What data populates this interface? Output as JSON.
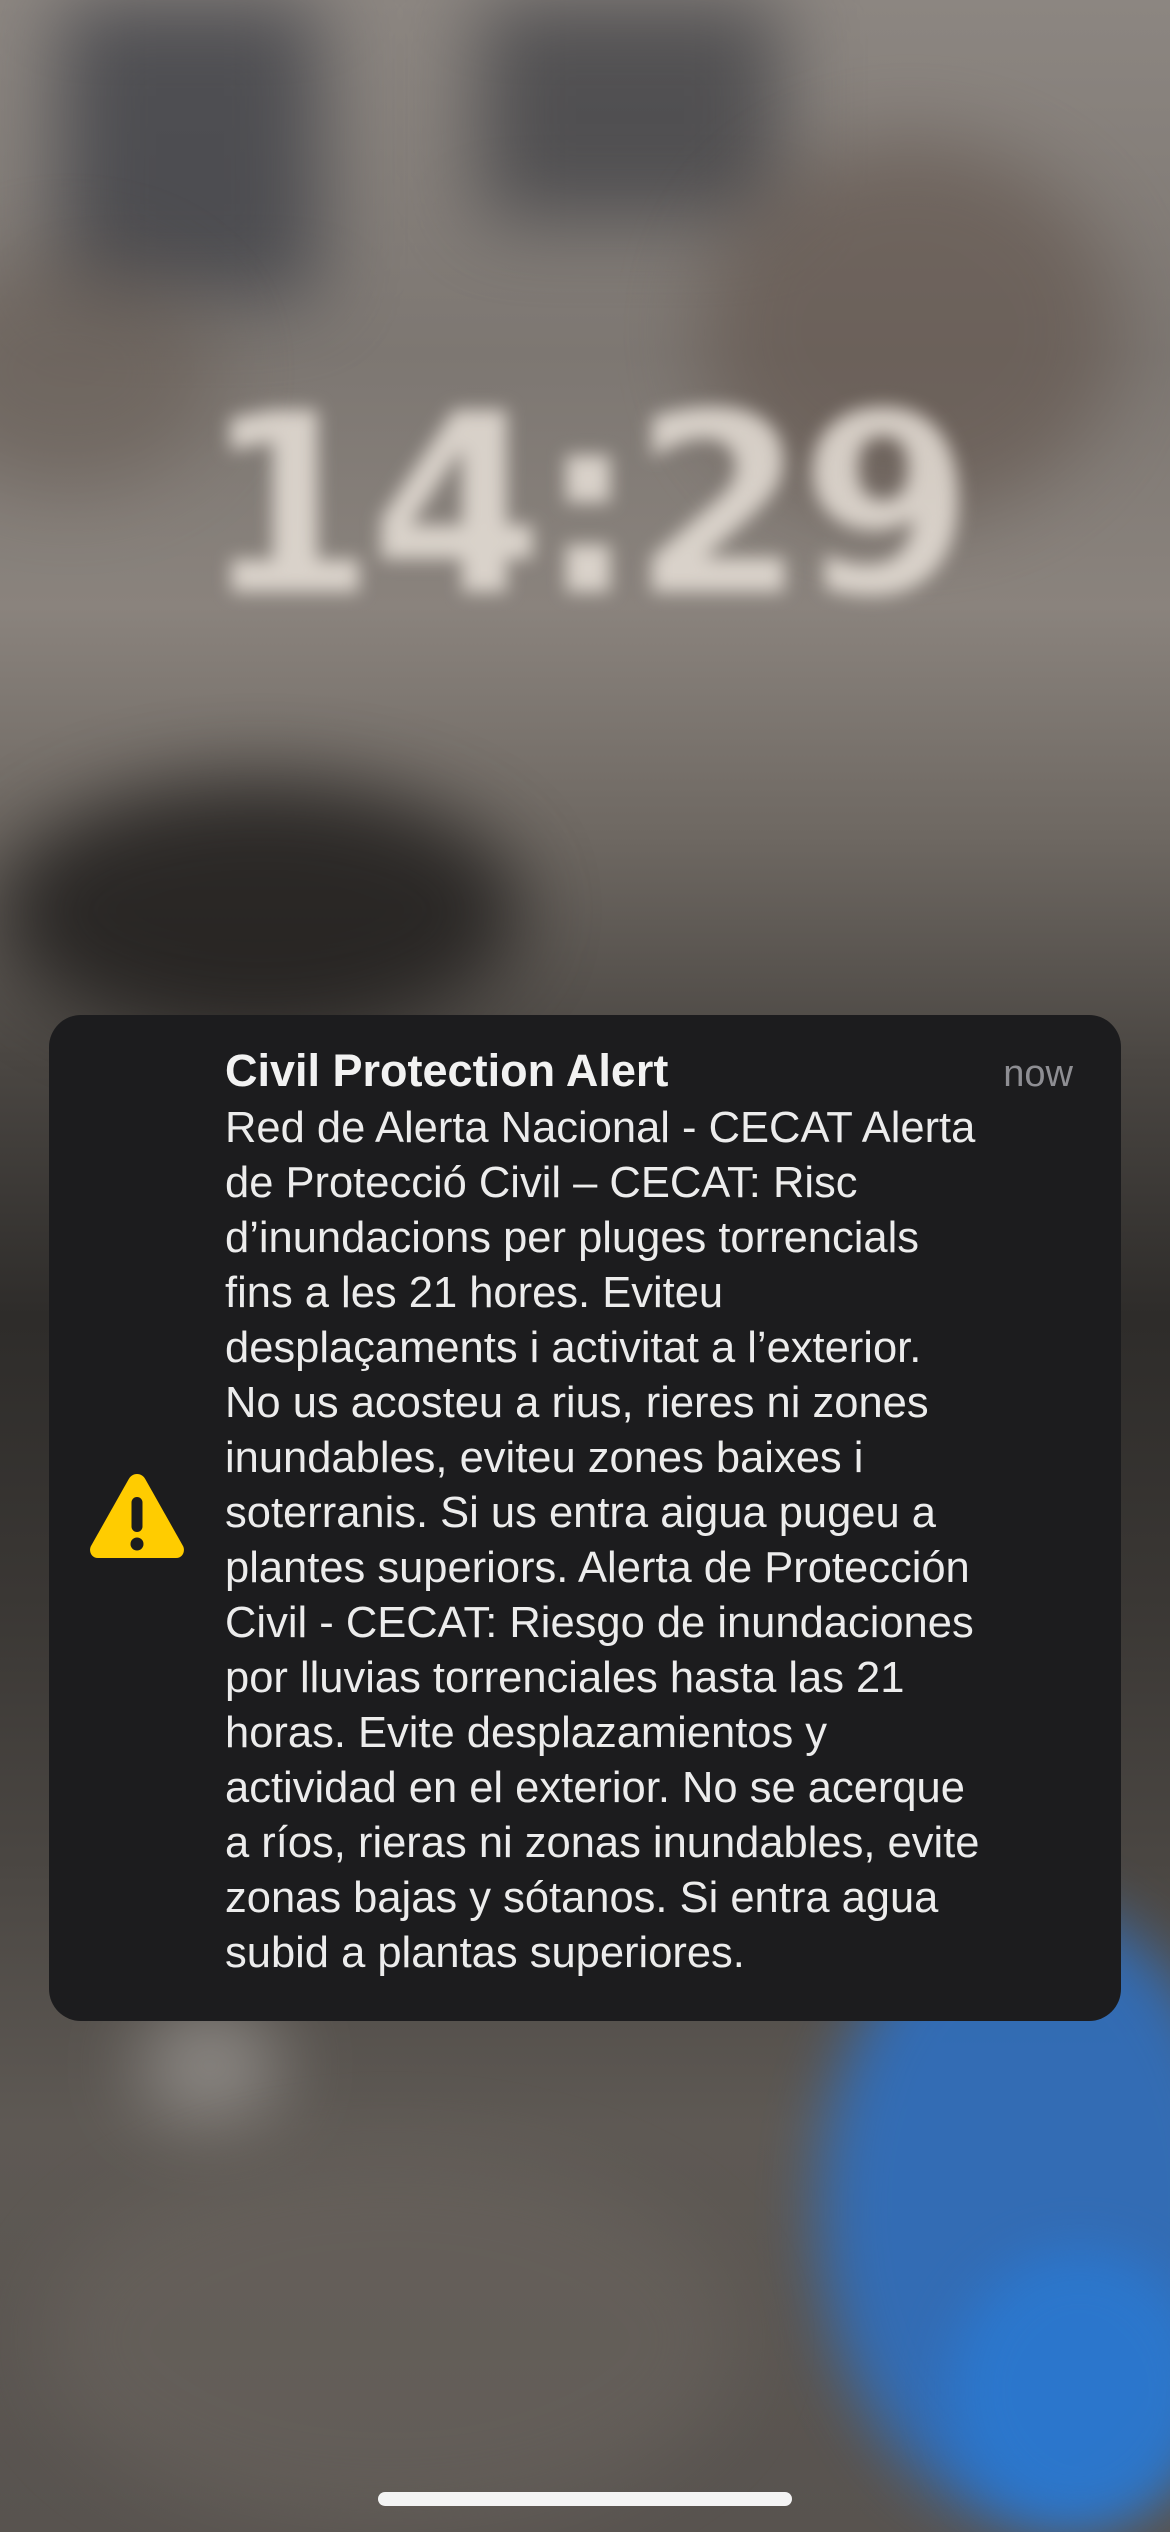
{
  "lock_screen": {
    "time": "14:29"
  },
  "notification": {
    "title": "Civil Protection Alert",
    "timestamp": "now",
    "icon": "warning-triangle-icon",
    "icon_color": "#FFCC00",
    "body_lines": [
      "Red de Alerta Nacional - CECAT Alerta",
      "de Protecció Civil – CECAT: Risc",
      "d’inundacions per pluges torrencials",
      "fins a les 21 hores. Eviteu",
      "desplaçaments i activitat a l’exterior.",
      "No us acosteu a rius, rieres ni zones",
      "inundables, eviteu zones baixes i",
      "soterranis. Si us entra aigua pugeu a",
      "plantes superiors. Alerta de Protección",
      "Civil - CECAT: Riesgo de inundaciones",
      "por lluvias torrenciales hasta las 21",
      "horas. Evite desplazamientos y",
      "actividad en el exterior. No se acerque",
      "a ríos, rieras ni zonas inundables, evite",
      "zonas bajas y sótanos. Si entra agua",
      "subid a plantas superiores."
    ]
  }
}
